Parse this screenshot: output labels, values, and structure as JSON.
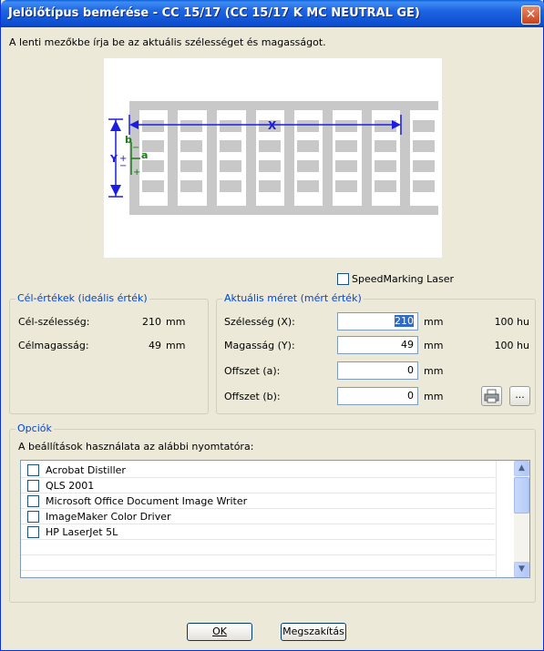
{
  "window": {
    "title": "Jelölőtípus bemérése - CC 15/17 (CC 15/17 K MC NEUTRAL GE)",
    "close_glyph": "✕"
  },
  "instruction": "A lenti mezőkbe írja be az aktuális szélességet és magasságot.",
  "diagram": {
    "x_label": "X",
    "y_label": "Y",
    "a_label": "a",
    "b_label": "b",
    "plus": "+",
    "minus": "−"
  },
  "speedmarking": {
    "label": "SpeedMarking Laser",
    "checked": false
  },
  "target_group": {
    "legend": "Cél-értékek (ideális érték)",
    "rows": [
      {
        "label": "Cél-szélesség:",
        "value": "210",
        "unit": "mm"
      },
      {
        "label": "Célmagasság:",
        "value": "49",
        "unit": "mm"
      }
    ]
  },
  "actual_group": {
    "legend": "Aktuális méret (mért érték)",
    "rows": [
      {
        "label": "Szélesség (X):",
        "value": "210",
        "unit": "mm",
        "hu": "100 hu"
      },
      {
        "label": "Magasság (Y):",
        "value": "49",
        "unit": "mm",
        "hu": "100 hu"
      },
      {
        "label": "Offszet (a):",
        "value": "0",
        "unit": "mm"
      },
      {
        "label": "Offszet (b):",
        "value": "0",
        "unit": "mm"
      }
    ],
    "print_icon": "printer-icon",
    "more_label": "..."
  },
  "options_group": {
    "legend": "Opciók",
    "description": "A beállítások használata az alábbi nyomtatóra:",
    "printers": [
      "Acrobat Distiller",
      "QLS 2001",
      "Microsoft Office Document Image Writer",
      "ImageMaker Color Driver",
      "HP LaserJet 5L"
    ]
  },
  "buttons": {
    "ok": "OK",
    "cancel": "Megszakítás"
  },
  "colors": {
    "title_blue": "#0c4fd0",
    "legend_blue": "#0046d5",
    "diagram_blue": "#1d1de0",
    "diagram_green": "#1a7a1a",
    "label_gray": "#c8c8c8"
  }
}
